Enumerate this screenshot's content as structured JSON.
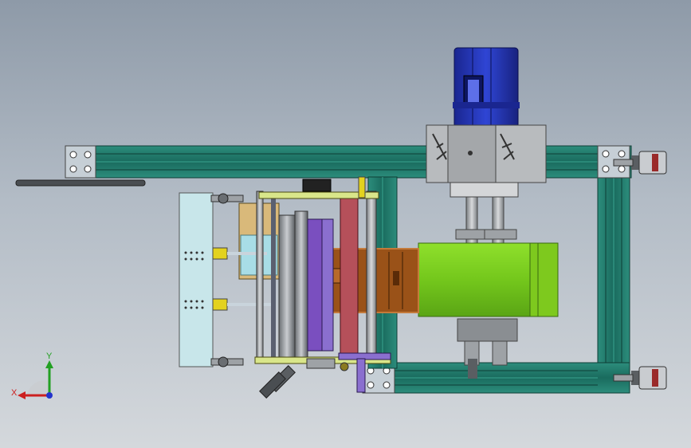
{
  "viewport": {
    "background_top": "#8e9aa8",
    "background_bottom": "#d4d8dc"
  },
  "triad": {
    "x_label": "X",
    "y_label": "Y",
    "x_color": "#cc1f1f",
    "y_color": "#22a022",
    "z_color": "#2233cc"
  },
  "colors": {
    "frame_profile": "#1f7a6a",
    "motor": "#1e2fa8",
    "gearbox": "#a9acb0",
    "guard": "#7ed321",
    "drum": "#9a5218",
    "tank": "#a8dde6",
    "purple": "#7a4fbf",
    "red": "#b5505a",
    "yellow_cap": "#e3d21e"
  },
  "icons": [
    "coordinate-triad-icon"
  ]
}
